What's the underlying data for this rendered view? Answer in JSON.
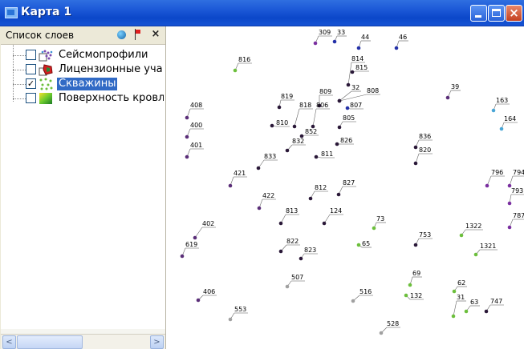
{
  "window": {
    "title": "Карта 1",
    "close_glyph": "×",
    "accent": "#0b47c9"
  },
  "layers_panel": {
    "title": "Список слоев",
    "close_glyph": "×",
    "icons": [
      "globe-icon",
      "flag-icon",
      "close-icon"
    ],
    "items": [
      {
        "label": "Сейсмопрофили",
        "checked": false,
        "icon": "seismic-profiles-icon"
      },
      {
        "label": "Лицензионные уча",
        "checked": false,
        "icon": "license-areas-icon"
      },
      {
        "label": "Скважины",
        "checked": true,
        "selected": true,
        "icon": "wells-icon"
      },
      {
        "label": "Поверхность кровл",
        "checked": false,
        "icon": "surface-icon"
      }
    ],
    "check_glyph": "✓",
    "scroll_left_glyph": "<",
    "scroll_right_glyph": ">"
  },
  "map": {
    "colors": {
      "purple": "#5a2e78",
      "violet": "#7a2fa0",
      "green": "#6cbf3c",
      "blue": "#2431a8",
      "cyan": "#4aa6d6",
      "gray": "#a0a0a0",
      "dark": "#2a1838"
    },
    "wells": [
      {
        "label": "309",
        "color": "violet"
      },
      {
        "label": "33",
        "color": "blue"
      },
      {
        "label": "44",
        "color": "blue"
      },
      {
        "label": "46",
        "color": "blue"
      },
      {
        "label": "816",
        "color": "green"
      },
      {
        "label": "814",
        "color": "dark"
      },
      {
        "label": "815",
        "color": "dark"
      },
      {
        "label": "39",
        "color": "purple"
      },
      {
        "label": "809",
        "color": "dark"
      },
      {
        "label": "32",
        "color": "dark"
      },
      {
        "label": "808",
        "color": "dark"
      },
      {
        "label": "819",
        "color": "dark"
      },
      {
        "label": "818",
        "color": "dark"
      },
      {
        "label": "806",
        "color": "dark"
      },
      {
        "label": "807",
        "color": "blue"
      },
      {
        "label": "163",
        "color": "cyan"
      },
      {
        "label": "408",
        "color": "purple"
      },
      {
        "label": "805",
        "color": "dark"
      },
      {
        "label": "164",
        "color": "cyan"
      },
      {
        "label": "810",
        "color": "dark"
      },
      {
        "label": "852",
        "color": "dark"
      },
      {
        "label": "400",
        "color": "purple"
      },
      {
        "label": "836",
        "color": "dark"
      },
      {
        "label": "832",
        "color": "dark"
      },
      {
        "label": "826",
        "color": "dark"
      },
      {
        "label": "401",
        "color": "purple"
      },
      {
        "label": "820",
        "color": "dark"
      },
      {
        "label": "833",
        "color": "dark"
      },
      {
        "label": "811",
        "color": "dark"
      },
      {
        "label": "421",
        "color": "purple"
      },
      {
        "label": "796",
        "color": "violet"
      },
      {
        "label": "794",
        "color": "violet"
      },
      {
        "label": "827",
        "color": "dark"
      },
      {
        "label": "812",
        "color": "dark"
      },
      {
        "label": "422",
        "color": "purple"
      },
      {
        "label": "793",
        "color": "violet"
      },
      {
        "label": "813",
        "color": "dark"
      },
      {
        "label": "124",
        "color": "dark"
      },
      {
        "label": "73",
        "color": "green"
      },
      {
        "label": "402",
        "color": "purple"
      },
      {
        "label": "787",
        "color": "violet"
      },
      {
        "label": "1322",
        "color": "green"
      },
      {
        "label": "753",
        "color": "dark"
      },
      {
        "label": "822",
        "color": "dark"
      },
      {
        "label": "65",
        "color": "green"
      },
      {
        "label": "619",
        "color": "purple"
      },
      {
        "label": "1321",
        "color": "green"
      },
      {
        "label": "823",
        "color": "dark"
      },
      {
        "label": "507",
        "color": "gray"
      },
      {
        "label": "69",
        "color": "green"
      },
      {
        "label": "62",
        "color": "green"
      },
      {
        "label": "406",
        "color": "purple"
      },
      {
        "label": "516",
        "color": "gray"
      },
      {
        "label": "132",
        "color": "green"
      },
      {
        "label": "31",
        "color": "green"
      },
      {
        "label": "63",
        "color": "green"
      },
      {
        "label": "747",
        "color": "dark"
      },
      {
        "label": "553",
        "color": "gray"
      },
      {
        "label": "528",
        "color": "gray"
      }
    ]
  }
}
